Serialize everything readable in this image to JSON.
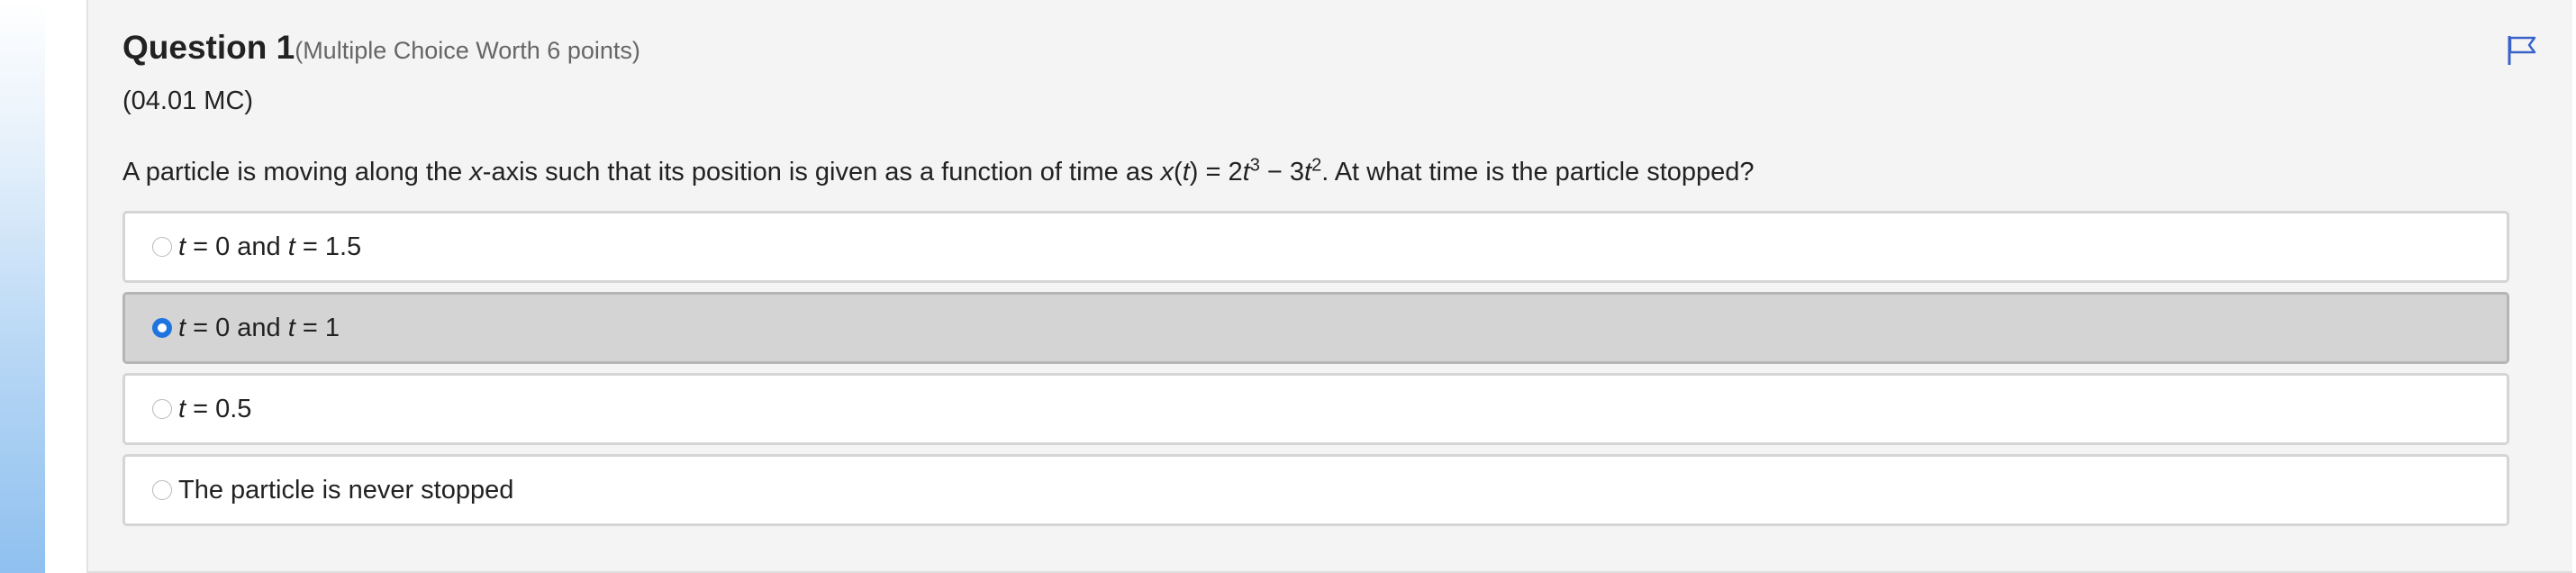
{
  "question": {
    "title": "Question 1",
    "worth": "(Multiple Choice Worth 6 points)",
    "code": "(04.01 MC)",
    "stem": {
      "part1": "A particle is moving along the ",
      "x_axis_var": "x",
      "part2": "-axis such that its position is given as a function of time as ",
      "fn_x": "x",
      "paren_open": "(",
      "fn_t": "t",
      "paren_close_eq": ") = 2",
      "t1": "t",
      "exp1": "3",
      "minus": " − 3",
      "t2": "t",
      "exp2": "2",
      "part3": ". At what time is the particle stopped?"
    },
    "flag_icon": "flag-icon",
    "accent_color": "#1f74e0"
  },
  "choices": [
    {
      "t1": "t",
      "text1": " = 0 and ",
      "t2": "t",
      "text2": " = 1.5",
      "selected": false
    },
    {
      "t1": "t",
      "text1": " = 0 and ",
      "t2": "t",
      "text2": " = 1",
      "selected": true
    },
    {
      "t1": "t",
      "text1": " = 0.5",
      "selected": false
    },
    {
      "text1": "The particle is never stopped",
      "selected": false
    }
  ]
}
